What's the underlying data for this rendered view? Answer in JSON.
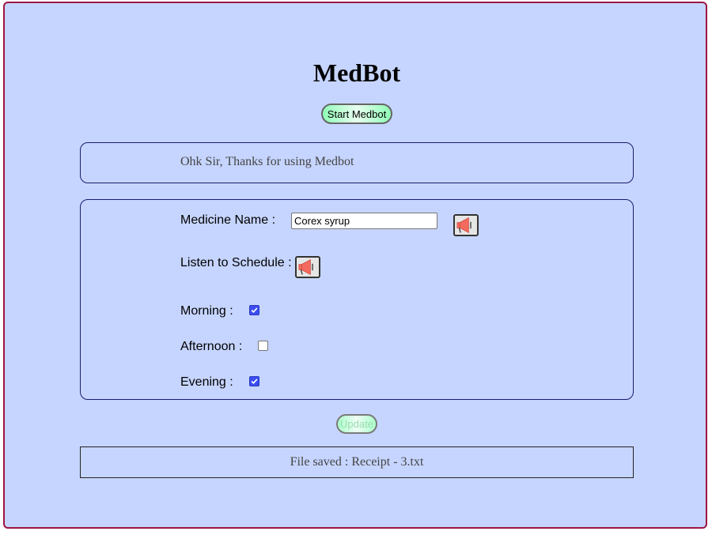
{
  "app": {
    "title": "MedBot",
    "start_label": "Start Medbot"
  },
  "message": {
    "text": "Ohk Sir, Thanks for using Medbot"
  },
  "form": {
    "medicine_label": "Medicine Name :",
    "medicine_value": "Corex syrup",
    "schedule_label": "Listen to Schedule :",
    "morning_label": "Morning :",
    "morning_checked": true,
    "afternoon_label": "Afternoon :",
    "afternoon_checked": false,
    "evening_label": "Evening :",
    "evening_checked": true,
    "speaker_icon": "megaphone-icon"
  },
  "actions": {
    "update_label": "Update"
  },
  "status": {
    "text": "File saved : Receipt - 3.txt"
  },
  "colors": {
    "background": "#c6d5ff",
    "frame_border": "#9e1642",
    "button_green": "#8fffb6",
    "checkbox_accent": "#3b4df1"
  }
}
